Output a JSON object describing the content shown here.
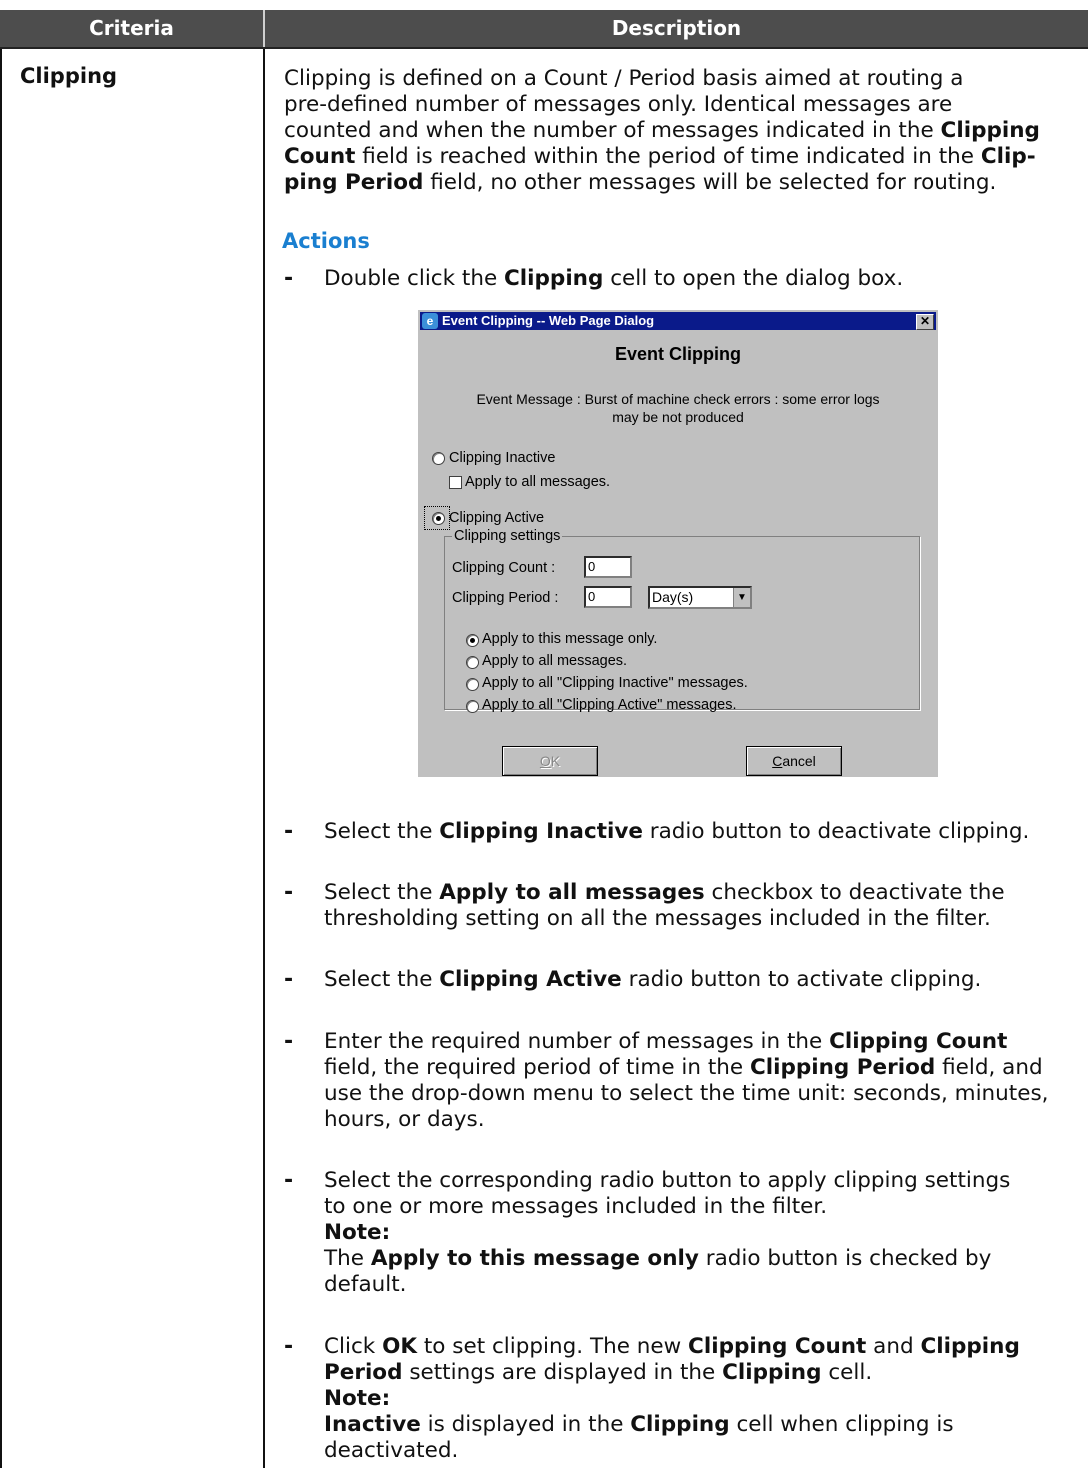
{
  "header": {
    "criteria": "Criteria",
    "description": "Description"
  },
  "criteria_label": "Clipping",
  "intro": {
    "l1": "Clipping is defined on a Count / Period basis aimed at routing a",
    "l2": "pre-defined number of messages only. Identical messages are",
    "l3a": "counted and when the number of messages indicated in the ",
    "l3b": "Clipping",
    "l4a": "Count",
    "l4b": " field is reached within the period of time indicated in the ",
    "l4c": "Clip-",
    "l5a": "ping Period",
    "l5b": " field, no other messages will be selected for routing."
  },
  "actions_heading": "Actions",
  "bullet_char": "-",
  "step1": {
    "a": "Double click the ",
    "b": "Clipping",
    "c": " cell to open the dialog box."
  },
  "dialog": {
    "title": "Event Clipping -- Web Page Dialog",
    "heading": "Event Clipping",
    "message_l1": "Event Message : Burst of machine check errors : some error logs",
    "message_l2": "may be not produced",
    "clipping_inactive": "Clipping Inactive",
    "apply_all_inactive": "Apply to all messages.",
    "clipping_active": "Clipping Active",
    "settings_group": "Clipping settings",
    "count_label": "Clipping Count :",
    "count_value": "0",
    "period_label": "Clipping Period :",
    "period_value": "0",
    "period_unit": "Day(s)",
    "opt1": "Apply to this message only.",
    "opt2": "Apply to all messages.",
    "opt3": "Apply to all \"Clipping Inactive\" messages.",
    "opt4": "Apply to all \"Clipping Active\" messages.",
    "ok_hot": "O",
    "ok_rest": "K",
    "cancel_hot": "C",
    "cancel_rest": "ancel"
  },
  "step2": {
    "a": "Select the ",
    "b": "Clipping Inactive",
    "c": " radio button to deactivate clipping."
  },
  "step3": {
    "a": "Select the ",
    "b": "Apply to all messages",
    "c": " checkbox to deactivate the",
    "l2": "thresholding setting on all the messages included in the filter."
  },
  "step4": {
    "a": "Select the ",
    "b": "Clipping Active",
    "c": " radio button to activate clipping."
  },
  "step5": {
    "l1a": "Enter the required number of messages in the ",
    "l1b": "Clipping Count",
    "l2a": "field, the required period of time in the ",
    "l2b": "Clipping Period",
    "l2c": " field, and",
    "l3": "use the drop-down menu to select the time unit: seconds, minutes,",
    "l4": "hours, or days."
  },
  "step6": {
    "l1": "Select the corresponding radio button to apply clipping settings",
    "l2": "to one or more messages included in the filter.",
    "note": "Note:",
    "l4a": "The ",
    "l4b": "Apply to this message only",
    "l4c": " radio button is checked by",
    "l5": "default."
  },
  "step7": {
    "l1a": "Click ",
    "l1b": "OK",
    "l1c": " to set clipping. The new ",
    "l1d": "Clipping Count",
    "l1e": " and ",
    "l1f": "Clipping",
    "l2a": "Period",
    "l2b": " settings are displayed in the ",
    "l2c": "Clipping",
    "l2d": " cell.",
    "note": "Note:",
    "l4a": "Inactive",
    "l4b": " is displayed in the ",
    "l4c": "Clipping",
    "l4d": " cell when clipping is",
    "l5": "deactivated."
  }
}
